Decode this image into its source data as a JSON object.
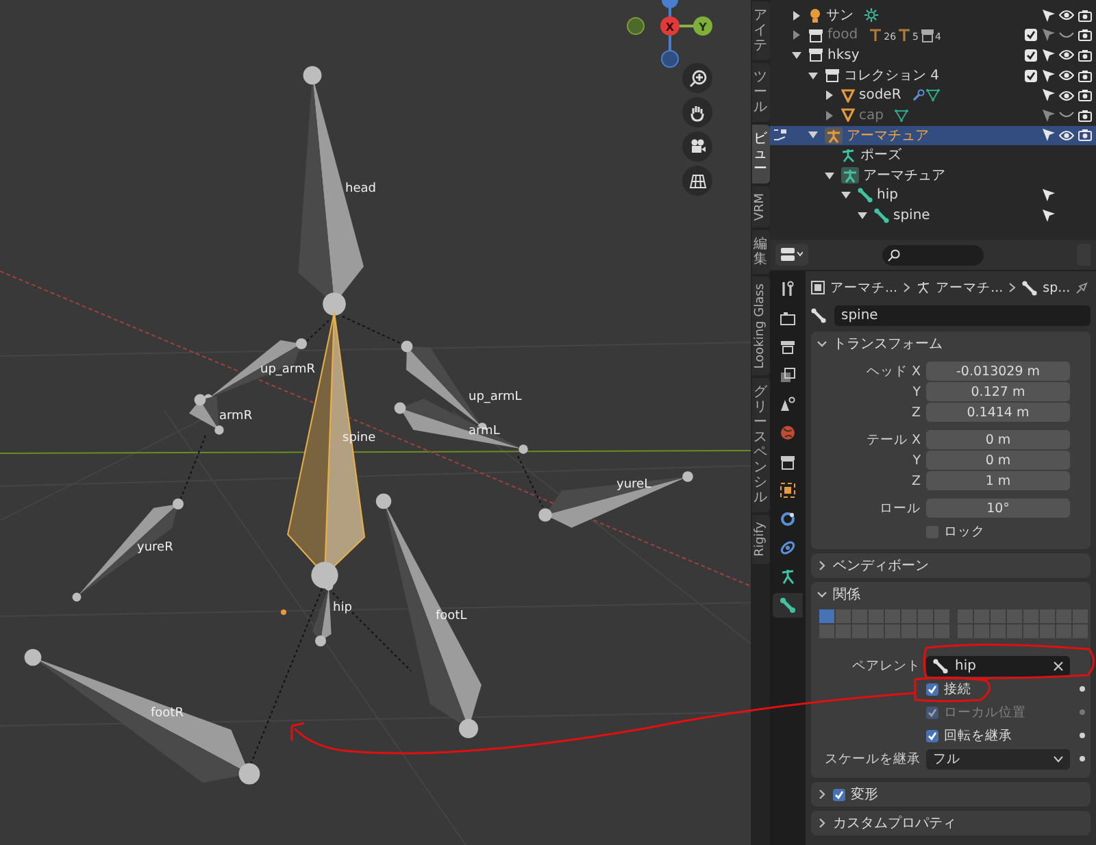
{
  "viewport": {
    "gizmo_labels": [
      "X",
      "Y"
    ],
    "bones": [
      {
        "name": "head",
        "selected": false
      },
      {
        "name": "up_armR",
        "selected": false
      },
      {
        "name": "armR",
        "selected": false
      },
      {
        "name": "spine",
        "selected": true
      },
      {
        "name": "up_armL",
        "selected": false
      },
      {
        "name": "armL",
        "selected": false
      },
      {
        "name": "yureL",
        "selected": false
      },
      {
        "name": "yureR",
        "selected": false
      },
      {
        "name": "hip",
        "selected": false
      },
      {
        "name": "footL",
        "selected": false
      },
      {
        "name": "footR",
        "selected": false
      }
    ]
  },
  "sidebar_tabs": [
    {
      "label": "アイテ",
      "kind": "stacked",
      "selected": false
    },
    {
      "label": "ツール",
      "kind": "stacked",
      "selected": false
    },
    {
      "label": "ビュー",
      "kind": "stacked",
      "selected": true
    },
    {
      "label": "VRM",
      "kind": "rotated",
      "selected": false
    },
    {
      "label": "編集",
      "kind": "stacked",
      "selected": false
    },
    {
      "label": "Looking Glass",
      "kind": "rotated",
      "selected": false
    },
    {
      "label": "グリースペンシル",
      "kind": "stacked",
      "selected": false
    },
    {
      "label": "Rigify",
      "kind": "rotated",
      "selected": false
    }
  ],
  "outliner": {
    "rows": [
      {
        "name": "サン",
        "kind": "light",
        "expanded": false,
        "selected": false,
        "disabled": false,
        "visible": true
      },
      {
        "name": "food",
        "kind": "collection",
        "expanded": false,
        "selected": false,
        "disabled": true,
        "checked": true,
        "visible": false,
        "badges": [
          "26",
          "5",
          "4"
        ]
      },
      {
        "name": "hksy",
        "kind": "collection",
        "expanded": true,
        "selected": false,
        "disabled": false,
        "checked": true,
        "visible": true,
        "children": [
          {
            "name": "コレクション 4",
            "kind": "collection",
            "expanded": true,
            "selected": false,
            "disabled": false,
            "checked": true,
            "visible": true,
            "children": [
              {
                "name": "sodeR",
                "kind": "mesh",
                "expanded": false,
                "selected": false,
                "disabled": false,
                "visible": true
              },
              {
                "name": "cap",
                "kind": "mesh",
                "expanded": false,
                "selected": false,
                "disabled": true,
                "visible": false
              }
            ]
          },
          {
            "name": "アーマチュア",
            "kind": "armature",
            "expanded": true,
            "selected": true,
            "disabled": false,
            "visible": true,
            "children": [
              {
                "name": "ポーズ",
                "kind": "pose",
                "selected": false,
                "disabled": false
              },
              {
                "name": "アーマチュア",
                "kind": "armature_data",
                "expanded": true,
                "selected": false,
                "disabled": false,
                "children": [
                  {
                    "name": "hip",
                    "kind": "bone",
                    "expanded": true,
                    "selected": false,
                    "disabled": false,
                    "children": [
                      {
                        "name": "spine",
                        "kind": "bone",
                        "expanded": true,
                        "selected": false,
                        "disabled": false
                      }
                    ]
                  }
                ]
              }
            ]
          }
        ]
      }
    ]
  },
  "properties": {
    "tabs": [
      {
        "kind": "tool",
        "selected": false
      },
      {
        "kind": "render",
        "selected": false
      },
      {
        "kind": "output",
        "selected": false
      },
      {
        "kind": "view_layer",
        "selected": false
      },
      {
        "kind": "scene",
        "selected": false
      },
      {
        "kind": "world",
        "selected": false
      },
      {
        "kind": "collection",
        "selected": false
      },
      {
        "kind": "object",
        "selected": false
      },
      {
        "kind": "constraint",
        "selected": false
      },
      {
        "kind": "physics",
        "selected": false
      },
      {
        "kind": "armature",
        "selected": false
      },
      {
        "kind": "bone",
        "selected": true
      }
    ],
    "breadcrumb": [
      "アーマチ...",
      "アーマチ...",
      "sp..."
    ],
    "bone_name": "spine",
    "transform": {
      "title": "トランスフォーム",
      "expanded": true,
      "rows": [
        {
          "label": "ヘッド X",
          "value": "-0.013029 m"
        },
        {
          "label": "Y",
          "value": "0.127 m"
        },
        {
          "label": "Z",
          "value": "0.1414 m"
        },
        {
          "label": "テール X",
          "value": "0 m"
        },
        {
          "label": "Y",
          "value": "0 m"
        },
        {
          "label": "Z",
          "value": "1 m"
        },
        {
          "label": "ロール",
          "value": "10°"
        }
      ],
      "lock": {
        "label": "ロック",
        "checked": false
      }
    },
    "bendy_bones": {
      "title": "ベンディボーン",
      "expanded": false
    },
    "relations": {
      "title": "関係",
      "expanded": true,
      "layers": [
        {
          "on": true
        },
        {
          "on": false
        },
        {
          "on": false
        },
        {
          "on": false
        },
        {
          "on": false
        },
        {
          "on": false
        },
        {
          "on": false
        },
        {
          "on": false
        },
        {
          "on": false
        },
        {
          "on": false
        },
        {
          "on": false
        },
        {
          "on": false
        },
        {
          "on": false
        },
        {
          "on": false
        },
        {
          "on": false
        },
        {
          "on": false
        },
        {
          "on": false
        },
        {
          "on": false
        },
        {
          "on": false
        },
        {
          "on": false
        },
        {
          "on": false
        },
        {
          "on": false
        },
        {
          "on": false
        },
        {
          "on": false
        },
        {
          "on": false
        },
        {
          "on": false
        },
        {
          "on": false
        },
        {
          "on": false
        },
        {
          "on": false
        },
        {
          "on": false
        },
        {
          "on": false
        },
        {
          "on": false
        }
      ],
      "parent_label": "ペアレント",
      "parent": "hip",
      "options": [
        {
          "label": "接続",
          "checked": true,
          "disabled": false
        },
        {
          "label": "ローカル位置",
          "checked": true,
          "disabled": true
        },
        {
          "label": "回転を継承",
          "checked": true,
          "disabled": false
        }
      ],
      "inherit_scale_label": "スケールを継承",
      "inherit_scale": "フル"
    },
    "deform": {
      "title": "変形",
      "expanded": false,
      "checked": true
    },
    "custom_props": {
      "title": "カスタムプロパティ",
      "expanded": false
    }
  }
}
